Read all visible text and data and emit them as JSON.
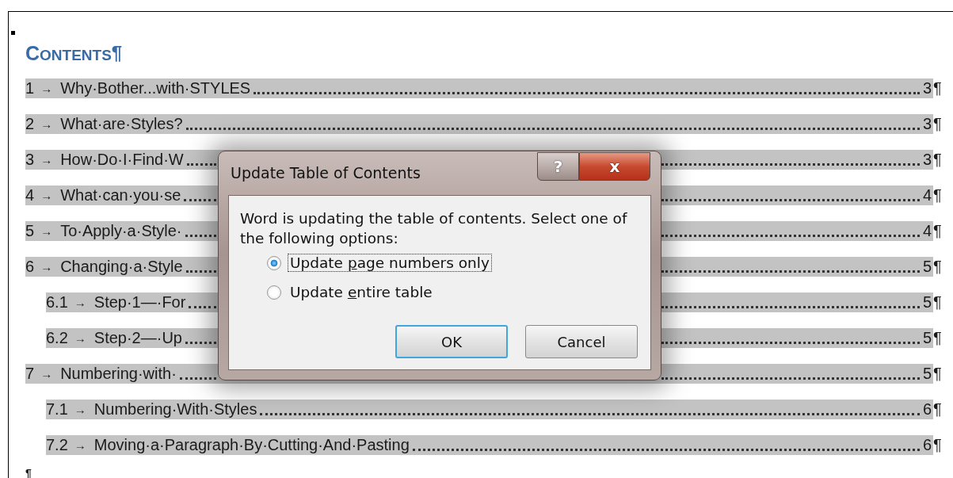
{
  "document": {
    "heading": "CONTENTS",
    "heading_mark": "¶",
    "toc": [
      {
        "number": "1",
        "tab": "→",
        "title": "Why·Bother...with·STYLES",
        "page": "3",
        "mark": "¶"
      },
      {
        "number": "2",
        "tab": "→",
        "title": "What·are·Styles?",
        "page": "3",
        "mark": "¶"
      },
      {
        "number": "3",
        "tab": "→",
        "title": "How·Do·I·Find·W",
        "page": "3",
        "mark": "¶"
      },
      {
        "number": "4",
        "tab": "→",
        "title": "What·can·you·se",
        "page": "4",
        "mark": "¶"
      },
      {
        "number": "5",
        "tab": "→",
        "title": "To·Apply·a·Style·",
        "page": "4",
        "mark": "¶"
      },
      {
        "number": "6",
        "tab": "→",
        "title": "Changing·a·Style",
        "page": "5",
        "mark": "¶",
        "children": [
          {
            "number": "6.1",
            "tab": "→",
            "title": "Step·1—·For",
            "page": "5",
            "mark": "¶"
          },
          {
            "number": "6.2",
            "tab": "→",
            "title": "Step·2—·Up",
            "page": "5",
            "mark": "¶"
          }
        ]
      },
      {
        "number": "7",
        "tab": "→",
        "title": "Numbering·with·",
        "page": "5",
        "mark": "¶",
        "children": [
          {
            "number": "7.1",
            "tab": "→",
            "title": "Numbering·With·Styles",
            "page": "6",
            "mark": "¶"
          },
          {
            "number": "7.2",
            "tab": "→",
            "title": "Moving·a·Paragraph·By·Cutting·And·Pasting",
            "page": "6",
            "mark": "¶"
          }
        ]
      }
    ],
    "end_mark": "¶"
  },
  "dialog": {
    "title": "Update Table of Contents",
    "help": "?",
    "close": "x",
    "message": "Word is updating the table of contents.  Select one of the following options:",
    "options": [
      {
        "before": "Update ",
        "access_key": "p",
        "after": "age numbers only",
        "selected": true,
        "focused": true
      },
      {
        "before": "Update ",
        "access_key": "e",
        "after": "ntire table",
        "selected": false,
        "focused": false
      }
    ],
    "buttons": [
      {
        "label": "OK",
        "default": true
      },
      {
        "label": "Cancel",
        "default": false
      }
    ]
  }
}
